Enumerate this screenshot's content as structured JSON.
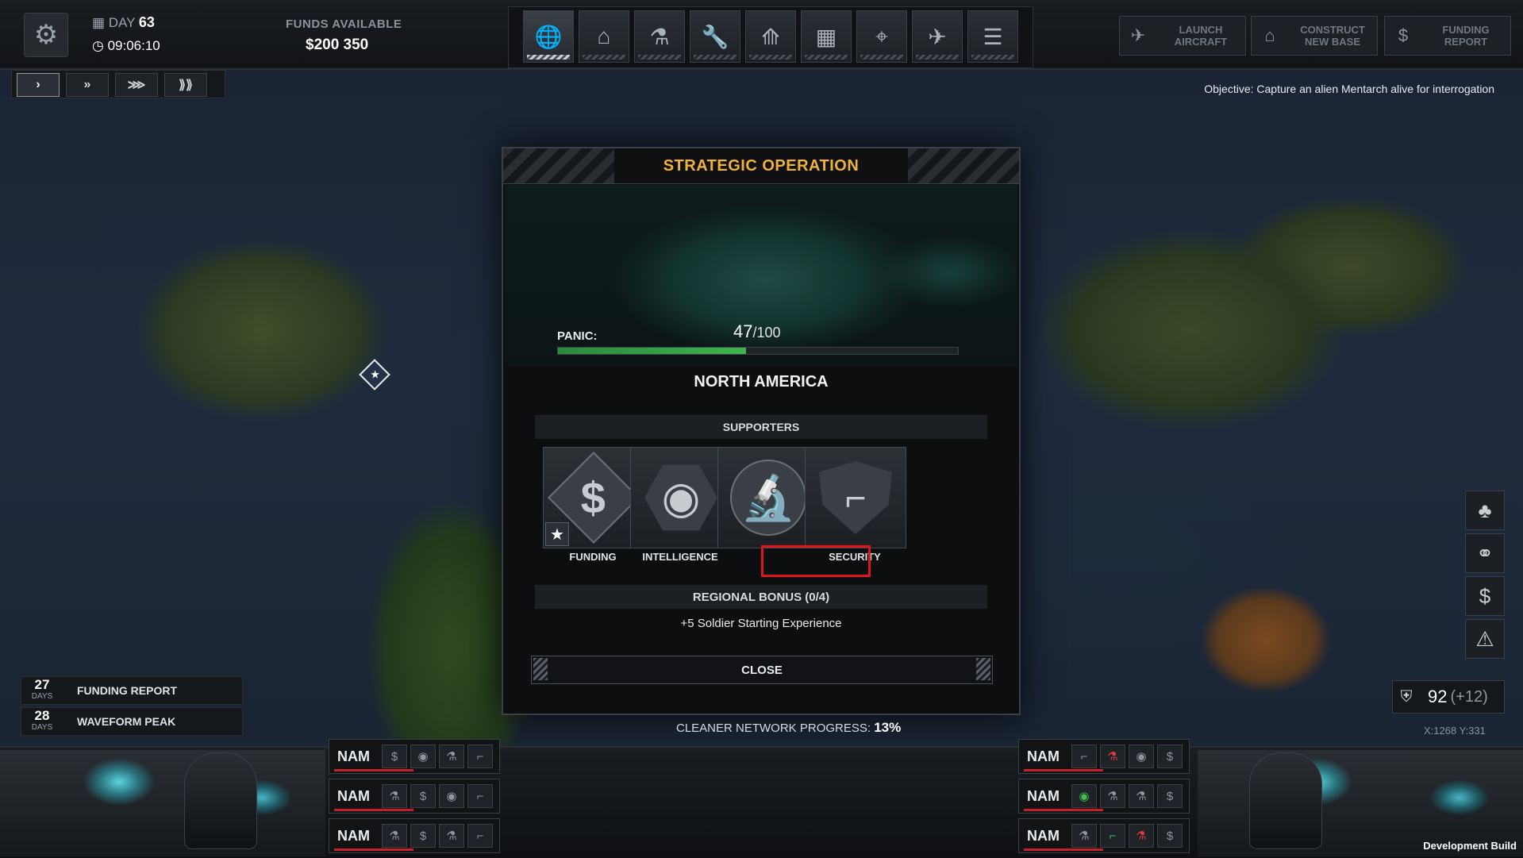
{
  "top": {
    "day_label": "DAY",
    "day_value": "63",
    "time": "09:06:10",
    "funds_label": "FUNDS AVAILABLE",
    "funds_value": "$200 350",
    "tabs": [
      {
        "icon": "globe-icon",
        "glyph": "🌐"
      },
      {
        "icon": "base-dome-icon",
        "glyph": "⌂"
      },
      {
        "icon": "research-icon",
        "glyph": "⚗"
      },
      {
        "icon": "engineering-icon",
        "glyph": "🔧"
      },
      {
        "icon": "soldiers-rank-icon",
        "glyph": "⟰"
      },
      {
        "icon": "facilities-icon",
        "glyph": "▦"
      },
      {
        "icon": "weapons-icon",
        "glyph": "⌖"
      },
      {
        "icon": "aircraft-icon",
        "glyph": "✈"
      },
      {
        "icon": "archives-icon",
        "glyph": "☰"
      }
    ],
    "actions": [
      {
        "label": "LAUNCH AIRCRAFT",
        "icon": "launch-aircraft-icon",
        "glyph": "✈"
      },
      {
        "label": "CONSTRUCT NEW BASE",
        "icon": "construct-base-icon",
        "glyph": "⌂"
      },
      {
        "label": "FUNDING REPORT",
        "icon": "funding-report-icon",
        "glyph": "$"
      }
    ]
  },
  "speed": [
    "›",
    "»",
    "⋙",
    "⟫⟫"
  ],
  "objective": "Objective: Capture an alien Mentarch alive for interrogation",
  "modal": {
    "title": "STRATEGIC OPERATION",
    "panic_label": "PANIC:",
    "panic_value": "47",
    "panic_max": "/100",
    "panic_fraction": 0.47,
    "region": "NORTH AMERICA",
    "supporters_label": "SUPPORTERS",
    "supporters": [
      {
        "label": "FUNDING",
        "icon": "funding-dollar-icon",
        "glyph": "$"
      },
      {
        "label": "INTELLIGENCE",
        "icon": "intelligence-eye-icon",
        "glyph": "◉"
      },
      {
        "label": "",
        "icon": "science-microscope-icon",
        "glyph": "🔬"
      },
      {
        "label": "SECURITY",
        "icon": "security-shield-icon",
        "glyph": "⌐"
      }
    ],
    "bonus_label": "REGIONAL BONUS  (0/4)",
    "bonus_text": "+5 Soldier Starting Experience",
    "close_label": "CLOSE"
  },
  "cleaner_label": "CLEANER NETWORK PROGRESS:",
  "cleaner_value": "13%",
  "events": [
    {
      "days": "27",
      "unit": "DAYS",
      "label": "FUNDING REPORT"
    },
    {
      "days": "28",
      "unit": "DAYS",
      "label": "WAVEFORM PEAK"
    }
  ],
  "side_buttons": [
    "♣",
    "⚭",
    "$",
    "⚠"
  ],
  "score": {
    "value": "92",
    "bonus": "(+12)"
  },
  "coords": "X:1268  Y:331",
  "rows_left": [
    {
      "name": "NAM",
      "icons": [
        "$",
        "◉",
        "⚗",
        "⌐"
      ]
    },
    {
      "name": "NAM",
      "icons": [
        "⚗",
        "$",
        "◉",
        "⌐"
      ]
    },
    {
      "name": "NAM",
      "icons": [
        "⚗",
        "$",
        "⚗",
        "⌐"
      ]
    }
  ],
  "rows_right": [
    {
      "name": "NAM",
      "icons": [
        "⌐",
        "⚗",
        "◉",
        "$"
      ]
    },
    {
      "name": "NAM",
      "icons": [
        "◉",
        "⚗",
        "⚗",
        "$"
      ]
    },
    {
      "name": "NAM",
      "icons": [
        "⚗",
        "⌐",
        "⚗",
        "$"
      ]
    }
  ],
  "dev_build": "Development Build",
  "colors": {
    "accent": "#f0b23a",
    "panic": "#3fb24d",
    "highlight": "#e0141d"
  }
}
